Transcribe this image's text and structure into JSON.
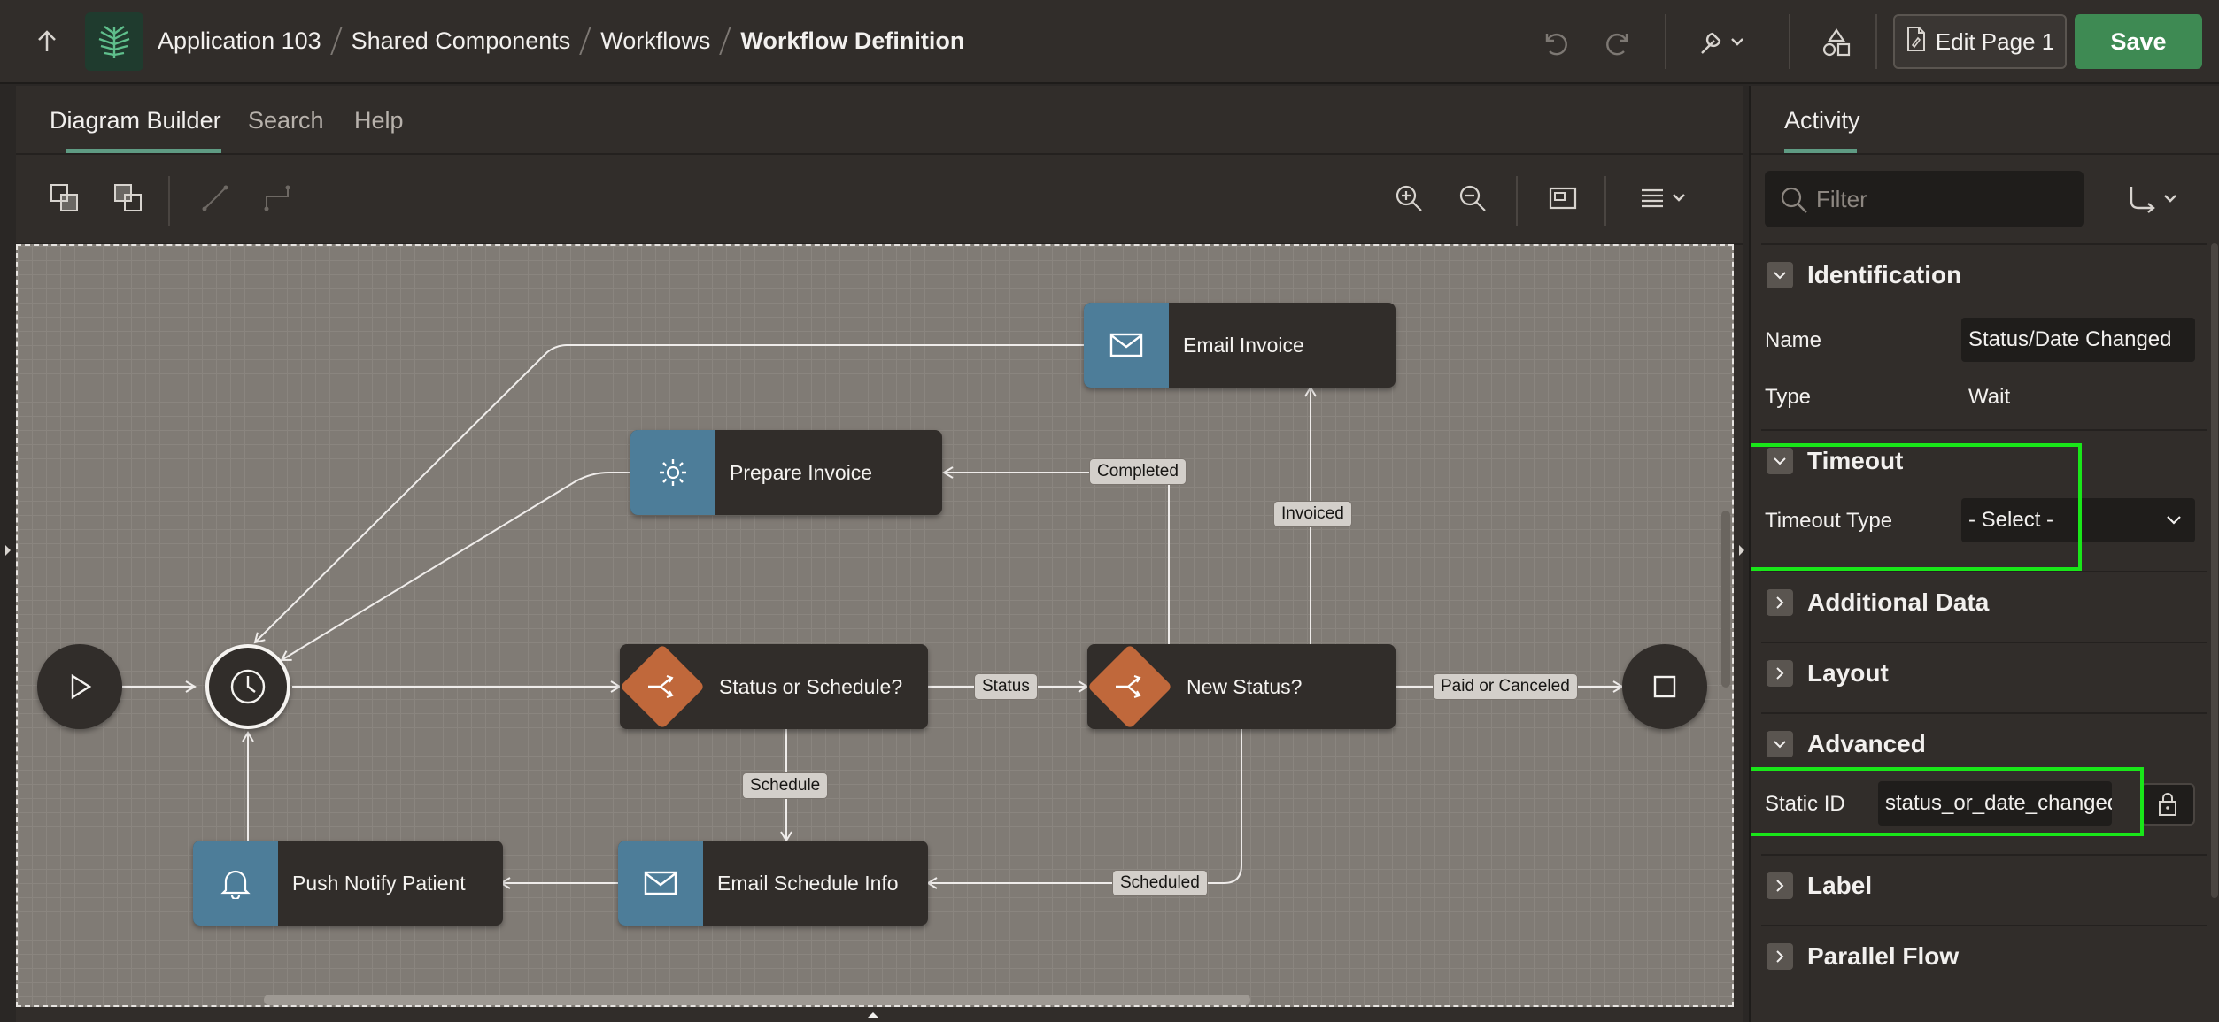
{
  "header": {
    "breadcrumbs": [
      "Application 103",
      "Shared Components",
      "Workflows"
    ],
    "current_page": "Workflow Definition",
    "edit_page_label": "Edit Page 1",
    "save_label": "Save"
  },
  "left_tabs": [
    "Diagram Builder",
    "Search",
    "Help"
  ],
  "diagram": {
    "nodes": {
      "email_invoice": "Email Invoice",
      "prepare_invoice": "Prepare Invoice",
      "status_or_schedule": "Status or Schedule?",
      "new_status": "New Status?",
      "push_notify": "Push Notify Patient",
      "email_schedule": "Email Schedule Info"
    },
    "edge_labels": {
      "completed": "Completed",
      "invoiced": "Invoiced",
      "status": "Status",
      "paid_or_canceled": "Paid or Canceled",
      "schedule": "Schedule",
      "scheduled": "Scheduled"
    }
  },
  "right_panel": {
    "tab": "Activity",
    "filter_placeholder": "Filter",
    "sections": {
      "identification": "Identification",
      "timeout": "Timeout",
      "additional_data": "Additional Data",
      "layout": "Layout",
      "advanced": "Advanced",
      "label": "Label",
      "parallel_flow": "Parallel Flow"
    },
    "props": {
      "name_label": "Name",
      "name_value": "Status/Date Changed",
      "type_label": "Type",
      "type_value": "Wait",
      "timeout_type_label": "Timeout Type",
      "timeout_type_value": "- Select -",
      "static_id_label": "Static ID",
      "static_id_value": "status_or_date_changed"
    }
  },
  "colors": {
    "accent_green": "#3e8a53",
    "activity_blue": "#4d7d99",
    "gateway_orange": "#c0683b",
    "highlight": "#19e619"
  }
}
